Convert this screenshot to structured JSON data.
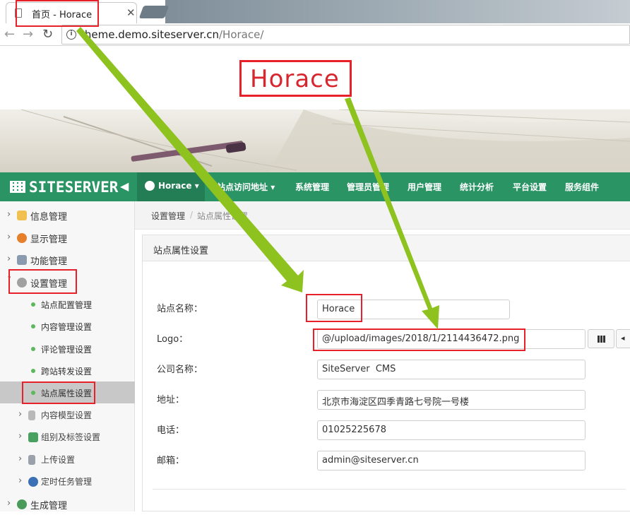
{
  "browser": {
    "tab_title": "首页 - Horace",
    "url_host": "theme.demo.siteserver.cn",
    "url_path": "/Horace/"
  },
  "site_logo": "Horace",
  "cms": {
    "brand": "SITESERVER",
    "site_switch": "Horace",
    "top_nav": [
      "站点访问地址",
      "系统管理",
      "管理员管理",
      "用户管理",
      "统计分析",
      "平台设置",
      "服务组件"
    ]
  },
  "sidebar": {
    "items": [
      {
        "label": "信息管理"
      },
      {
        "label": "显示管理"
      },
      {
        "label": "功能管理"
      },
      {
        "label": "设置管理"
      }
    ],
    "sub_items": [
      {
        "label": "站点配置管理"
      },
      {
        "label": "内容管理设置"
      },
      {
        "label": "评论管理设置"
      },
      {
        "label": "跨站转发设置"
      },
      {
        "label": "站点属性设置"
      }
    ],
    "sub_groups": [
      {
        "label": "内容模型设置"
      },
      {
        "label": "组别及标签设置"
      },
      {
        "label": "上传设置"
      },
      {
        "label": "定时任务管理"
      }
    ],
    "last_item": "生成管理"
  },
  "breadcrumb": {
    "parent": "设置管理",
    "current": "站点属性设置"
  },
  "panel": {
    "title": "站点属性设置",
    "fields": [
      {
        "label": "站点名称：",
        "value": "Horace"
      },
      {
        "label": "Logo：",
        "value": "@/upload/images/2018/1/2114436472.png"
      },
      {
        "label": "公司名称：",
        "value": "SiteServer  CMS"
      },
      {
        "label": "地址：",
        "value": "北京市海淀区四季青路七号院一号楼"
      },
      {
        "label": "电话：",
        "value": "01025225678"
      },
      {
        "label": "邮箱：",
        "value": "admin@siteserver.cn"
      }
    ]
  },
  "colors": {
    "header_green": "#2b9465",
    "annotation_red": "#e8202a",
    "arrow_green": "#8dc21f"
  }
}
